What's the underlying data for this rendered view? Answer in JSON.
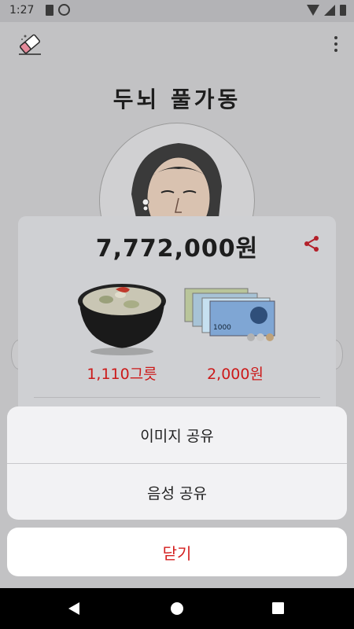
{
  "status_bar": {
    "time": "1:27",
    "icons": [
      "sim-card-icon",
      "sync-icon",
      "wifi-icon",
      "signal-icon",
      "battery-icon"
    ]
  },
  "app_bar": {
    "left_icon": "eraser-icon",
    "right_icon": "more-vert-icon"
  },
  "page": {
    "title": "두뇌 풀가동"
  },
  "result_card": {
    "amount": "7,772,000원",
    "share_icon": "share-icon",
    "items": [
      {
        "image": "soup-bowl-image",
        "label": "1,110그릇"
      },
      {
        "image": "banknotes-image",
        "label": "2,000원"
      }
    ]
  },
  "share_sheet": {
    "options": [
      "이미지 공유",
      "음성 공유"
    ],
    "cancel_label": "닫기"
  },
  "colors": {
    "accent_red": "#d41e1e",
    "sheet_bg": "#f2f2f4",
    "scrim": "#c2c2c4"
  },
  "nav_bar": {
    "icons": [
      "back-icon",
      "home-icon",
      "recents-icon"
    ]
  }
}
